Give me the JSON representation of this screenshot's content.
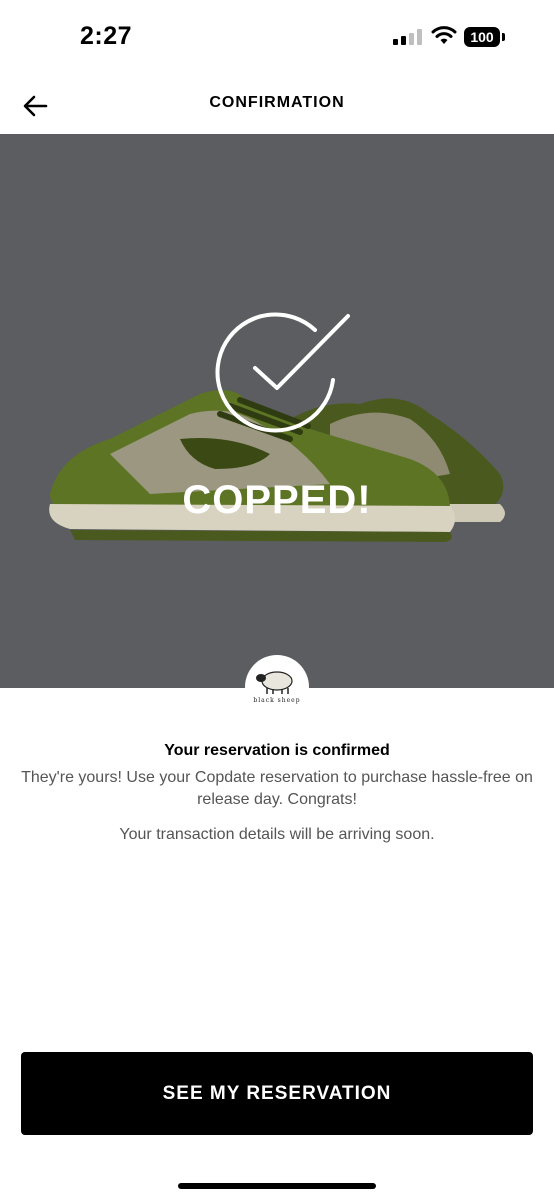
{
  "status_bar": {
    "time": "2:27",
    "battery": "100",
    "icons": [
      "signal-icon",
      "wifi-icon",
      "battery-icon"
    ]
  },
  "header": {
    "title": "CONFIRMATION",
    "back_icon": "arrow-left-icon"
  },
  "hero": {
    "headline": "COPPED!",
    "icon": "checkmark-icon",
    "background_color": "#5c5d60"
  },
  "brand": {
    "logo_text": "black sheep"
  },
  "confirmation": {
    "title": "Your reservation is confirmed",
    "body": "They're yours! Use your Copdate reservation to purchase hassle-free on release day. Congrats!",
    "note": "Your transaction details will be arriving soon."
  },
  "actions": {
    "primary_label": "SEE MY RESERVATION"
  }
}
